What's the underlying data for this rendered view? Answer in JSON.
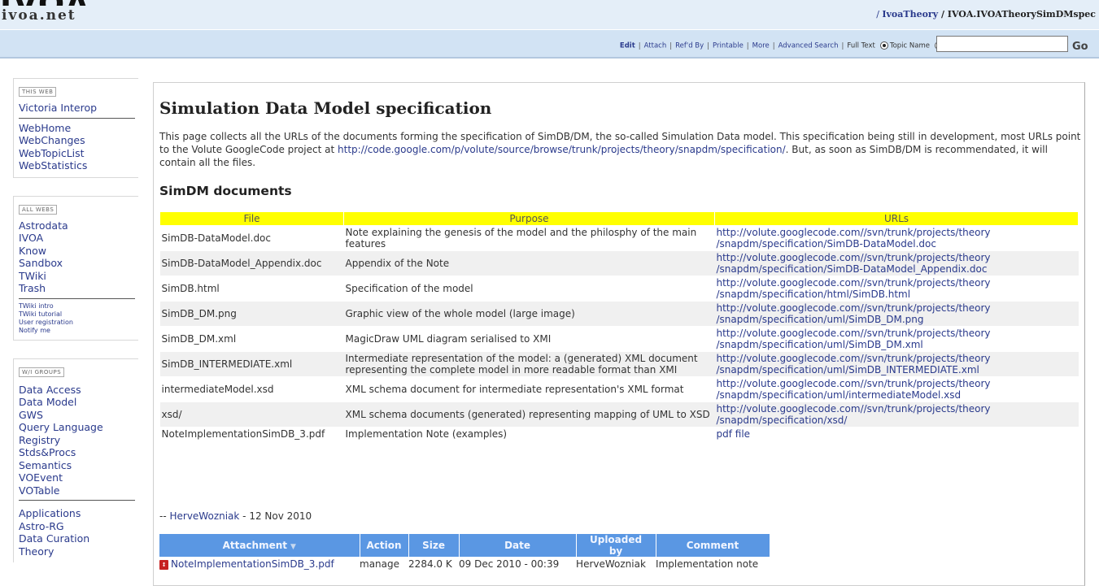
{
  "header": {
    "logo": "ivoa.net",
    "breadcrumb_sep1": "/ ",
    "breadcrumb_web": "IvoaTheory",
    "breadcrumb_sep2": " / ",
    "breadcrumb_topic": "IVOA.IVOATheorySimDMspec"
  },
  "toolbar": {
    "edit": "Edit",
    "attach": "Attach",
    "refd_by": "Ref'd By",
    "printable": "Printable",
    "more": "More",
    "advanced_search": "Advanced Search",
    "full_text": "Full Text",
    "topic_name": "Topic Name",
    "separator": "|",
    "go": "Go"
  },
  "sidebar": {
    "this_web": {
      "tag": "THIS WEB",
      "title": "Victoria Interop",
      "items": [
        "WebHome",
        "WebChanges",
        "WebTopicList",
        "WebStatistics"
      ]
    },
    "all_webs": {
      "tag": "ALL WEBS",
      "items": [
        "Astrodata",
        "IVOA",
        "Know",
        "Sandbox",
        "TWiki",
        "Trash"
      ],
      "small_items": [
        "TWiki intro",
        "TWiki tutorial",
        "User registration",
        "Notify me"
      ]
    },
    "wi_groups": {
      "tag": "W/I GROUPS",
      "items": [
        "Data Access",
        "Data Model",
        "GWS",
        "Query Language",
        "Registry",
        "Stds&Procs",
        "Semantics",
        "VOEvent",
        "VOTable"
      ],
      "items2": [
        "Applications",
        "Astro-RG",
        "Data Curation",
        "Theory"
      ]
    }
  },
  "main": {
    "title": "Simulation Data Model specification",
    "intro_before": "This page collects all the URLs of the documents forming the specification of SimDB/DM, the so-called Simulation Data model. This specification being still in development, most URLs point to the Volute GoogleCode project at ",
    "intro_link": "http://code.google.com/p/volute/source/browse/trunk/projects/theory/snapdm/specification/",
    "intro_after": ". But, as soon as SimDB/DM is recommendated, it will contain all the files.",
    "section_title": "SimDM documents",
    "table": {
      "headers": [
        "File",
        "Purpose",
        "URLs"
      ],
      "rows": [
        {
          "file": "SimDB-DataModel.doc",
          "purpose": "Note explaining the genesis of the model and the philosphy of the main features",
          "url1": "http://volute.googlecode.com//svn/trunk/projects/theory",
          "url2": "/snapdm/specification/SimDB-DataModel.doc"
        },
        {
          "file": "SimDB-DataModel_Appendix.doc",
          "purpose": "Appendix of the Note",
          "url1": "http://volute.googlecode.com//svn/trunk/projects/theory",
          "url2": "/snapdm/specification/SimDB-DataModel_Appendix.doc"
        },
        {
          "file": "SimDB.html",
          "purpose": "Specification of the model",
          "url1": "http://volute.googlecode.com//svn/trunk/projects/theory",
          "url2": "/snapdm/specification/html/SimDB.html"
        },
        {
          "file": "SimDB_DM.png",
          "purpose": "Graphic view of the whole model (large image)",
          "url1": "http://volute.googlecode.com//svn/trunk/projects/theory",
          "url2": "/snapdm/specification/uml/SimDB_DM.png"
        },
        {
          "file": "SimDB_DM.xml",
          "purpose": "MagicDraw UML diagram serialised to XMI",
          "url1": "http://volute.googlecode.com//svn/trunk/projects/theory",
          "url2": "/snapdm/specification/uml/SimDB_DM.xml"
        },
        {
          "file": "SimDB_INTERMEDIATE.xml",
          "purpose": "Intermediate representation of the model: a (generated) XML document representing the complete model in more readable format than XMI",
          "url1": "http://volute.googlecode.com//svn/trunk/projects/theory",
          "url2": "/snapdm/specification/uml/SimDB_INTERMEDIATE.xml"
        },
        {
          "file": "intermediateModel.xsd",
          "purpose": "XML schema document for intermediate representation's XML format",
          "url1": "http://volute.googlecode.com//svn/trunk/projects/theory",
          "url2": "/snapdm/specification/uml/intermediateModel.xsd"
        },
        {
          "file": "xsd/",
          "purpose": "XML schema documents (generated) representing mapping of UML to XSD",
          "url1": "http://volute.googlecode.com//svn/trunk/projects/theory",
          "url2": "/snapdm/specification/xsd/"
        },
        {
          "file": "NoteImplementationSimDB_3.pdf",
          "purpose": "Implementation Note (examples)",
          "url1": "pdf file",
          "url2": ""
        }
      ]
    },
    "signature_prefix": "-- ",
    "signature_name": "HerveWozniak",
    "signature_date": " - 12 Nov 2010",
    "attachments": {
      "headers": [
        "Attachment",
        "Action",
        "Size",
        "Date",
        "Uploaded by",
        "Comment"
      ],
      "rows": [
        {
          "name": "NoteImplementationSimDB_3.pdf",
          "action": "manage",
          "size": "2284.0 K",
          "date": "09 Dec 2010 - 00:39",
          "user": "HerveWozniak",
          "comment": "Implementation note"
        }
      ]
    }
  }
}
